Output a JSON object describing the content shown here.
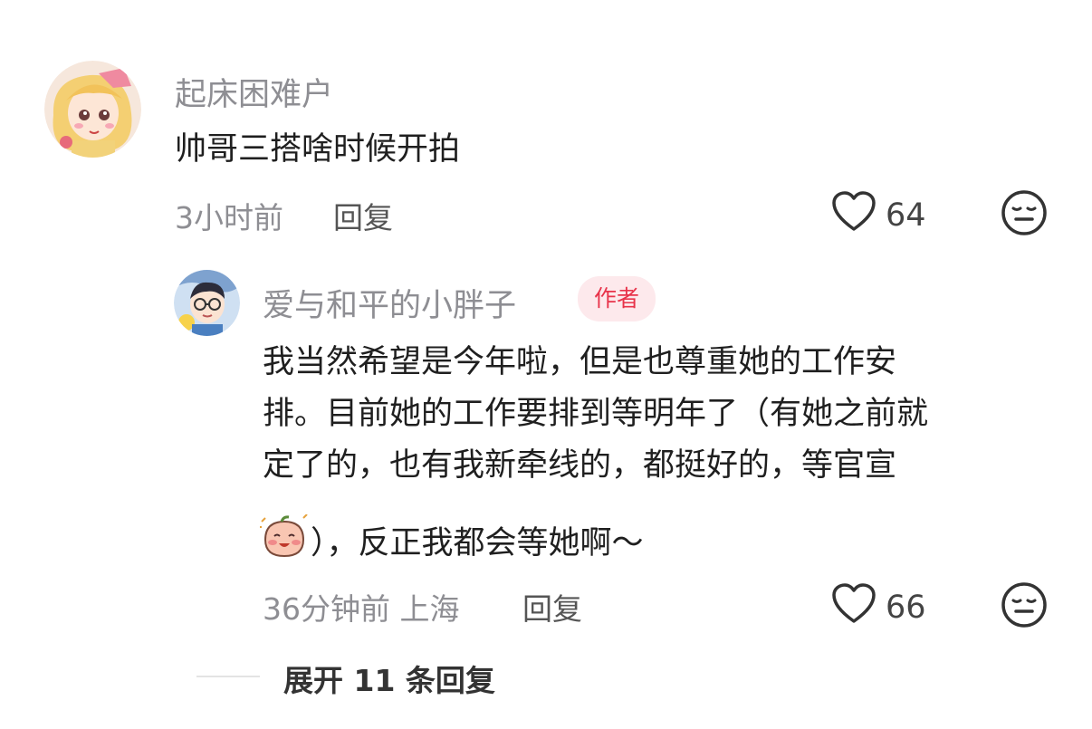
{
  "comment": {
    "username": "起床困难户",
    "text": "帅哥三搭啥时候开拍",
    "time": "3小时前",
    "reply_label": "回复",
    "likes": "64"
  },
  "reply": {
    "username": "爱与和平的小胖子",
    "author_badge": "作者",
    "text_lines": [
      "我当然希望是今年啦，但是也尊重她的工作安",
      "排。目前她的工作要排到等明年了（有她之前就",
      "定了的，也有我新牵线的，都挺好的，等官宣",
      "），反正我都会等她啊～"
    ],
    "time_location": "36分钟前 上海",
    "reply_label": "回复",
    "likes": "66"
  },
  "expand_label": "展开 11 条回复",
  "colors": {
    "badge_text": "#e8334a",
    "badge_bg": "#fde9ec",
    "meta_text": "#8e8e93"
  }
}
